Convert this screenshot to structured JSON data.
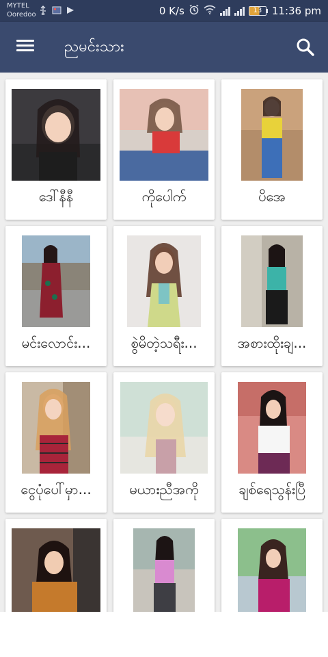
{
  "status_bar": {
    "carrier_line1": "MYTEL",
    "carrier_line2": "Ooredoo",
    "net_speed": "0 K/s",
    "battery": "13",
    "time": "11:36 pm",
    "icons": [
      "usb-icon",
      "image-icon",
      "media-icon",
      "alarm-icon",
      "wifi-icon",
      "signal-icon",
      "signal-icon",
      "battery-icon"
    ]
  },
  "app_bar": {
    "title": "ညမင်းသား",
    "menu_icon": "hamburger-menu-icon",
    "search_icon": "search-icon",
    "color": "#3a4a6e"
  },
  "grid": {
    "cards": [
      {
        "name": "ဒေါ်နီနီ"
      },
      {
        "name": "ကိုပေါက်"
      },
      {
        "name": "ပိအေ"
      },
      {
        "name": "မင်းလောင်း..."
      },
      {
        "name": "စွဲမိတဲ့သရီး..."
      },
      {
        "name": "အစားထိုးချ..."
      },
      {
        "name": "ငွေပုံပေါ်မှာ..."
      },
      {
        "name": "မယားညီအကို"
      },
      {
        "name": "ချစ်ရေသွန်းပြီ"
      },
      {
        "name": ""
      },
      {
        "name": ""
      },
      {
        "name": ""
      }
    ]
  }
}
